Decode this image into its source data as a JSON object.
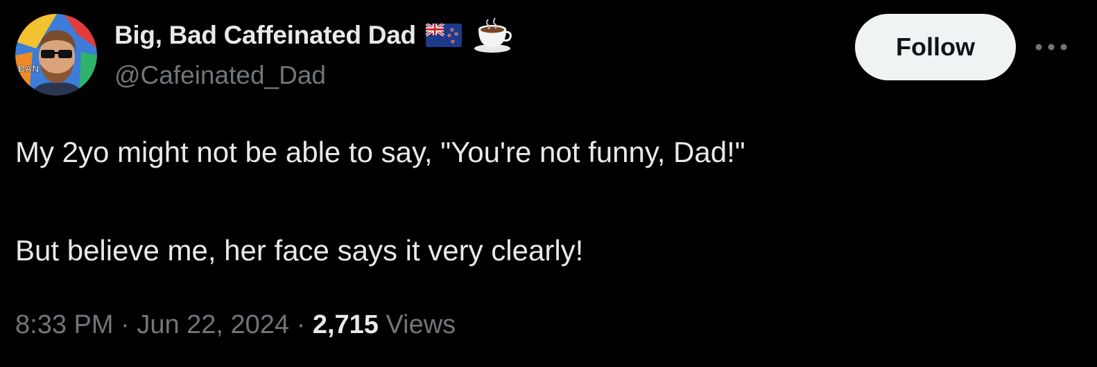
{
  "author": {
    "display_name": "Big, Bad Caffeinated Dad",
    "handle": "@Cafeinated_Dad",
    "badges": [
      "new-zealand-flag-icon",
      "coffee-cup-icon"
    ],
    "avatar_text": "BAN"
  },
  "actions": {
    "follow_label": "Follow",
    "more_label": "•••"
  },
  "tweet": {
    "line1": "My 2yo might not be able to say, \"You're not funny, Dad!\"",
    "line2": "But believe me, her face says it very clearly!"
  },
  "meta": {
    "time": "8:33 PM",
    "separator": " · ",
    "date": "Jun 22, 2024",
    "views_count": "2,715",
    "views_label": " Views"
  },
  "colors": {
    "background": "#000000",
    "primary_text": "#e7e9ea",
    "secondary_text": "#71767b",
    "follow_bg": "#eff3f4",
    "follow_text": "#0f1419"
  }
}
